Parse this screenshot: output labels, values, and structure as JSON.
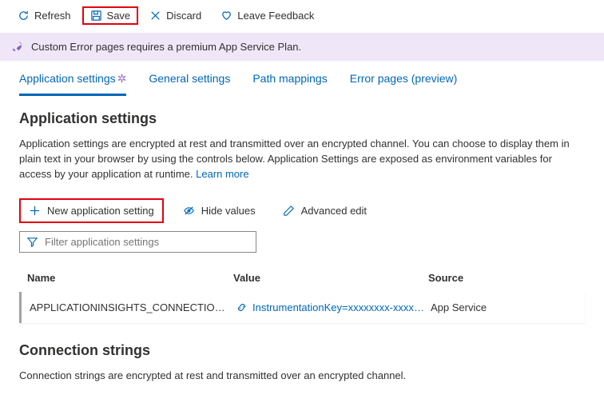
{
  "toolbar": {
    "refresh": "Refresh",
    "save": "Save",
    "discard": "Discard",
    "feedback": "Leave Feedback"
  },
  "banner": {
    "text": "Custom Error pages requires a premium App Service Plan."
  },
  "tabs": {
    "app_settings": "Application settings",
    "general_settings": "General settings",
    "path_mappings": "Path mappings",
    "error_pages": "Error pages (preview)"
  },
  "app_settings": {
    "title": "Application settings",
    "description": "Application settings are encrypted at rest and transmitted over an encrypted channel. You can choose to display them in plain text in your browser by using the controls below. Application Settings are exposed as environment variables for access by your application at runtime. ",
    "learn_more": "Learn more",
    "actions": {
      "new": "New application setting",
      "hide": "Hide values",
      "advanced": "Advanced edit"
    },
    "filter_placeholder": "Filter application settings",
    "columns": {
      "name": "Name",
      "value": "Value",
      "source": "Source"
    },
    "rows": [
      {
        "name": "APPLICATIONINSIGHTS_CONNECTION_STRING",
        "value": "InstrumentationKey=xxxxxxxx-xxxx-xxxx",
        "source": "App Service"
      }
    ]
  },
  "connection_strings": {
    "title": "Connection strings",
    "description": "Connection strings are encrypted at rest and transmitted over an encrypted channel."
  }
}
